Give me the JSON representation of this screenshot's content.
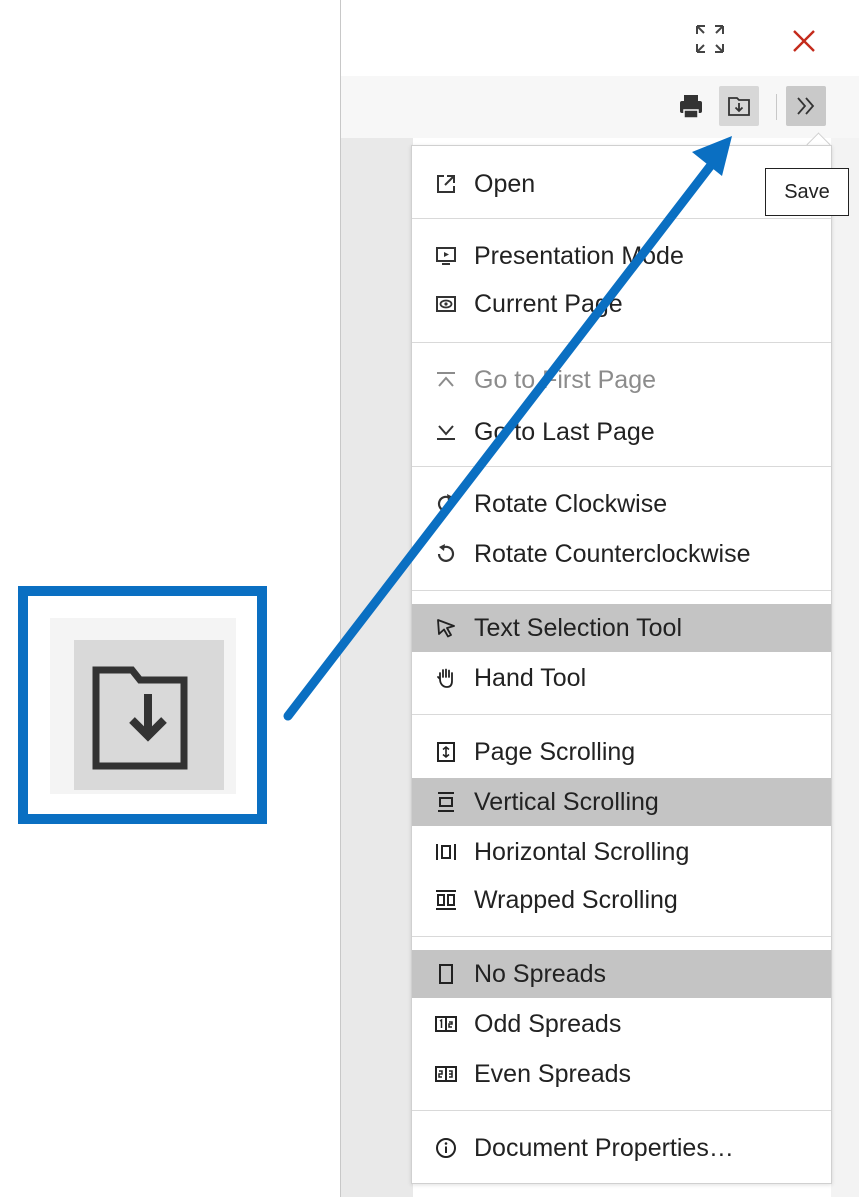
{
  "colors": {
    "accent": "#0a6fc2",
    "close": "#c42b1c",
    "selected_bg": "#c4c4c4",
    "disabled_text": "#8c8c8c"
  },
  "titlebar": {
    "fullscreen_icon": "fullscreen-icon",
    "close_icon": "close-icon"
  },
  "toolbar": {
    "print_icon": "print-icon",
    "save_icon": "save-icon",
    "more_icon": "double-chevron-right-icon",
    "tooltip": "Save"
  },
  "menu": {
    "items": [
      {
        "label": "Open",
        "icon": "open-external-icon",
        "state": "normal"
      },
      {
        "label": "Presentation Mode",
        "icon": "presentation-icon",
        "state": "normal"
      },
      {
        "label": "Current Page",
        "icon": "eye-icon",
        "state": "normal"
      },
      {
        "label": "Go to First Page",
        "icon": "first-page-icon",
        "state": "disabled"
      },
      {
        "label": "Go to Last Page",
        "icon": "last-page-icon",
        "state": "normal"
      },
      {
        "label": "Rotate Clockwise",
        "icon": "rotate-clockwise-icon",
        "state": "normal"
      },
      {
        "label": "Rotate Counterclockwise",
        "icon": "rotate-counterclockwise-icon",
        "state": "normal"
      },
      {
        "label": "Text Selection Tool",
        "icon": "cursor-icon",
        "state": "selected"
      },
      {
        "label": "Hand Tool",
        "icon": "hand-icon",
        "state": "normal"
      },
      {
        "label": "Page Scrolling",
        "icon": "page-scroll-icon",
        "state": "normal"
      },
      {
        "label": "Vertical Scrolling",
        "icon": "vertical-scroll-icon",
        "state": "selected"
      },
      {
        "label": "Horizontal Scrolling",
        "icon": "horizontal-scroll-icon",
        "state": "normal"
      },
      {
        "label": "Wrapped Scrolling",
        "icon": "wrapped-scroll-icon",
        "state": "normal"
      },
      {
        "label": "No Spreads",
        "icon": "no-spreads-icon",
        "state": "selected"
      },
      {
        "label": "Odd Spreads",
        "icon": "odd-spreads-icon",
        "state": "normal"
      },
      {
        "label": "Even Spreads",
        "icon": "even-spreads-icon",
        "state": "normal"
      },
      {
        "label": "Document Properties…",
        "icon": "info-icon",
        "state": "normal"
      }
    ]
  },
  "callout": {
    "icon": "save-icon"
  }
}
